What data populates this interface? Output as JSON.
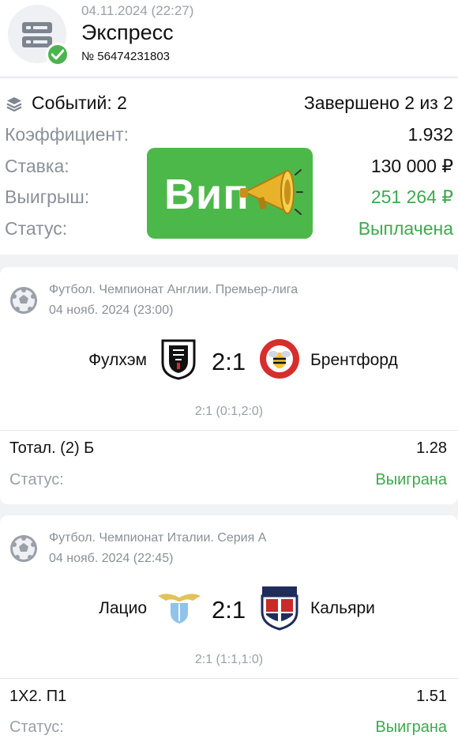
{
  "header": {
    "datetime": "04.11.2024 (22:27)",
    "title": "Экспресс",
    "number": "№ 56474231803",
    "icon": "server-stack-icon",
    "badge_icon": "checkmark-icon"
  },
  "summary": {
    "events_label": "Событий: 2",
    "completed": "Завершено 2 из 2",
    "rows": [
      {
        "label": "Коэффициент:",
        "value": "1.932"
      },
      {
        "label": "Ставка:",
        "value": "130 000 ₽"
      },
      {
        "label": "Выигрыш:",
        "value": "251 264 ₽"
      },
      {
        "label": "Статус:",
        "value": "Выплачена"
      }
    ]
  },
  "overlay": {
    "text": "Вип",
    "icon": "megaphone-icon"
  },
  "events": [
    {
      "league": "Футбол. Чемпионат Англии. Премьер-лига",
      "date": "04 нояб. 2024 (23:00)",
      "home": "Фулхэм",
      "away": "Брентфорд",
      "score": "2:1",
      "detail": "2:1 (0:1,2:0)",
      "bet": "Тотал. (2) Б",
      "coef": "1.28",
      "status_label": "Статус:",
      "status": "Выиграна"
    },
    {
      "league": "Футбол. Чемпионат Италии. Серия А",
      "date": "04 нояб. 2024 (22:45)",
      "home": "Лацио",
      "away": "Кальяри",
      "score": "2:1",
      "detail": "2:1 (1:1,1:0)",
      "bet": "1X2. П1",
      "coef": "1.51",
      "status_label": "Статус:",
      "status": "Выиграна"
    }
  ],
  "colors": {
    "accent_green": "#3daa4d",
    "vip_green": "#4cb84a",
    "muted_text": "#8a9099"
  }
}
